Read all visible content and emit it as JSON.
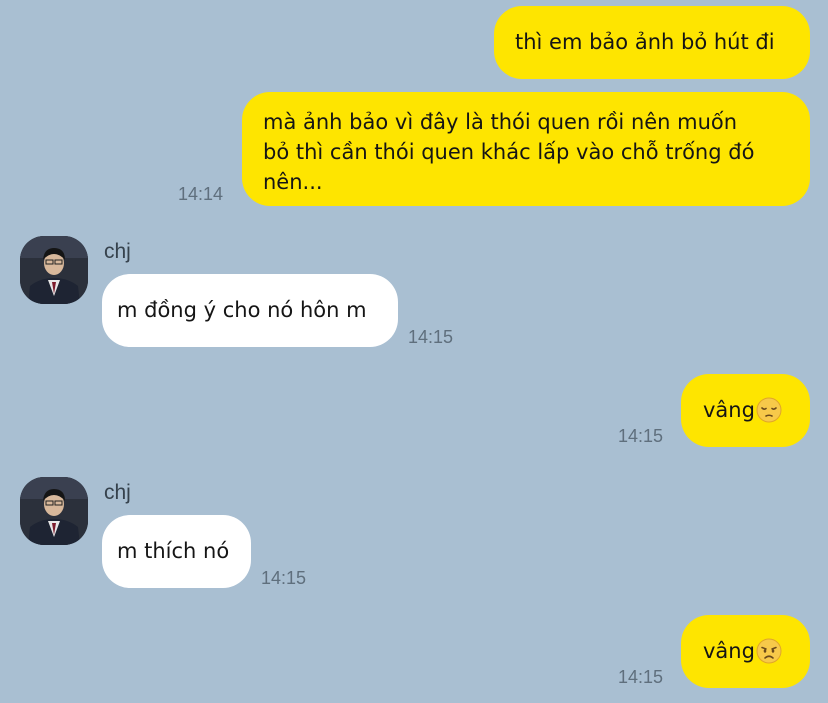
{
  "conversation": {
    "messages": [
      {
        "sender": "me",
        "text": "thì em bảo ảnh bỏ hút đi"
      },
      {
        "sender": "me",
        "lines": [
          "mà ảnh bảo vì đây là thói quen rồi nên muốn",
          "bỏ thì cần thói quen khác lấp vào chỗ trống đó",
          "nên..."
        ],
        "time": "14:14"
      },
      {
        "sender": "chj",
        "name": "chj",
        "text": "m đồng ý cho nó hôn m",
        "time": "14:15"
      },
      {
        "sender": "me",
        "text": "vâng",
        "emoji": "pensive-face-emoji",
        "time": "14:15"
      },
      {
        "sender": "chj",
        "name": "chj",
        "text": "m thích nó",
        "time": "14:15"
      },
      {
        "sender": "me",
        "text": "vâng",
        "emoji": "disappointed-face-emoji",
        "time": "14:15"
      }
    ]
  },
  "colors": {
    "background": "#a9bfd2",
    "outgoing_bubble": "#fee500",
    "incoming_bubble": "#ffffff"
  }
}
